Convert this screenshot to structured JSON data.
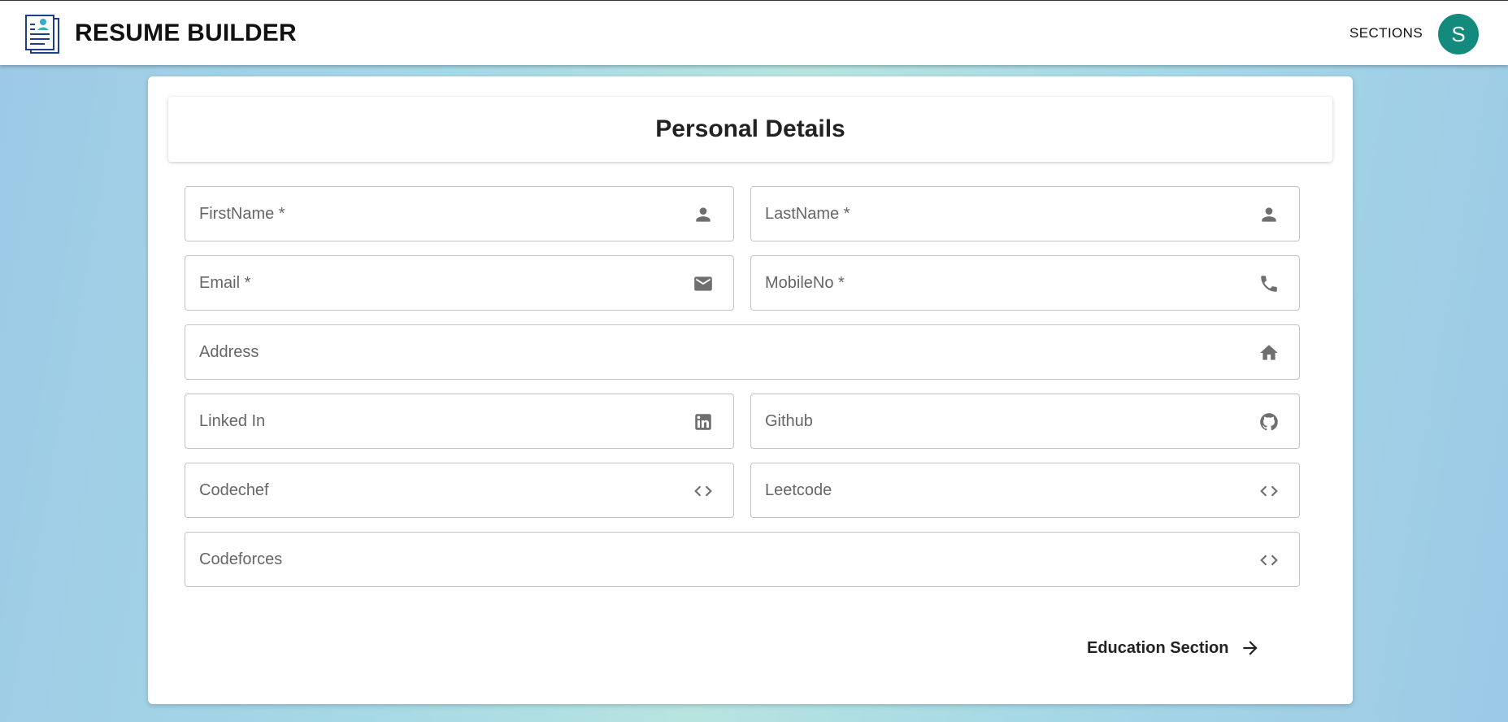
{
  "app": {
    "title": "RESUME BUILDER",
    "nav_sections_label": "SECTIONS",
    "avatar_initial": "S",
    "avatar_color": "#138a7c"
  },
  "form": {
    "section_title": "Personal Details",
    "fields": {
      "first_name": {
        "placeholder": "FirstName *",
        "value": "",
        "icon": "person-icon"
      },
      "last_name": {
        "placeholder": "LastName *",
        "value": "",
        "icon": "person-icon"
      },
      "email": {
        "placeholder": "Email *",
        "value": "",
        "icon": "email-icon"
      },
      "mobile": {
        "placeholder": "MobileNo *",
        "value": "",
        "icon": "phone-icon"
      },
      "address": {
        "placeholder": "Address",
        "value": "",
        "icon": "home-icon"
      },
      "linkedin": {
        "placeholder": "Linked In",
        "value": "",
        "icon": "linkedin-icon"
      },
      "github": {
        "placeholder": "Github",
        "value": "",
        "icon": "github-icon"
      },
      "codechef": {
        "placeholder": "Codechef",
        "value": "",
        "icon": "code-icon"
      },
      "leetcode": {
        "placeholder": "Leetcode",
        "value": "",
        "icon": "code-icon"
      },
      "codeforces": {
        "placeholder": "Codeforces",
        "value": "",
        "icon": "code-icon"
      }
    },
    "next_button_label": "Education Section",
    "next_icon": "arrow-right-icon"
  },
  "colors": {
    "icon_gray": "#6f6f6f",
    "field_border": "#c4c4c4"
  }
}
